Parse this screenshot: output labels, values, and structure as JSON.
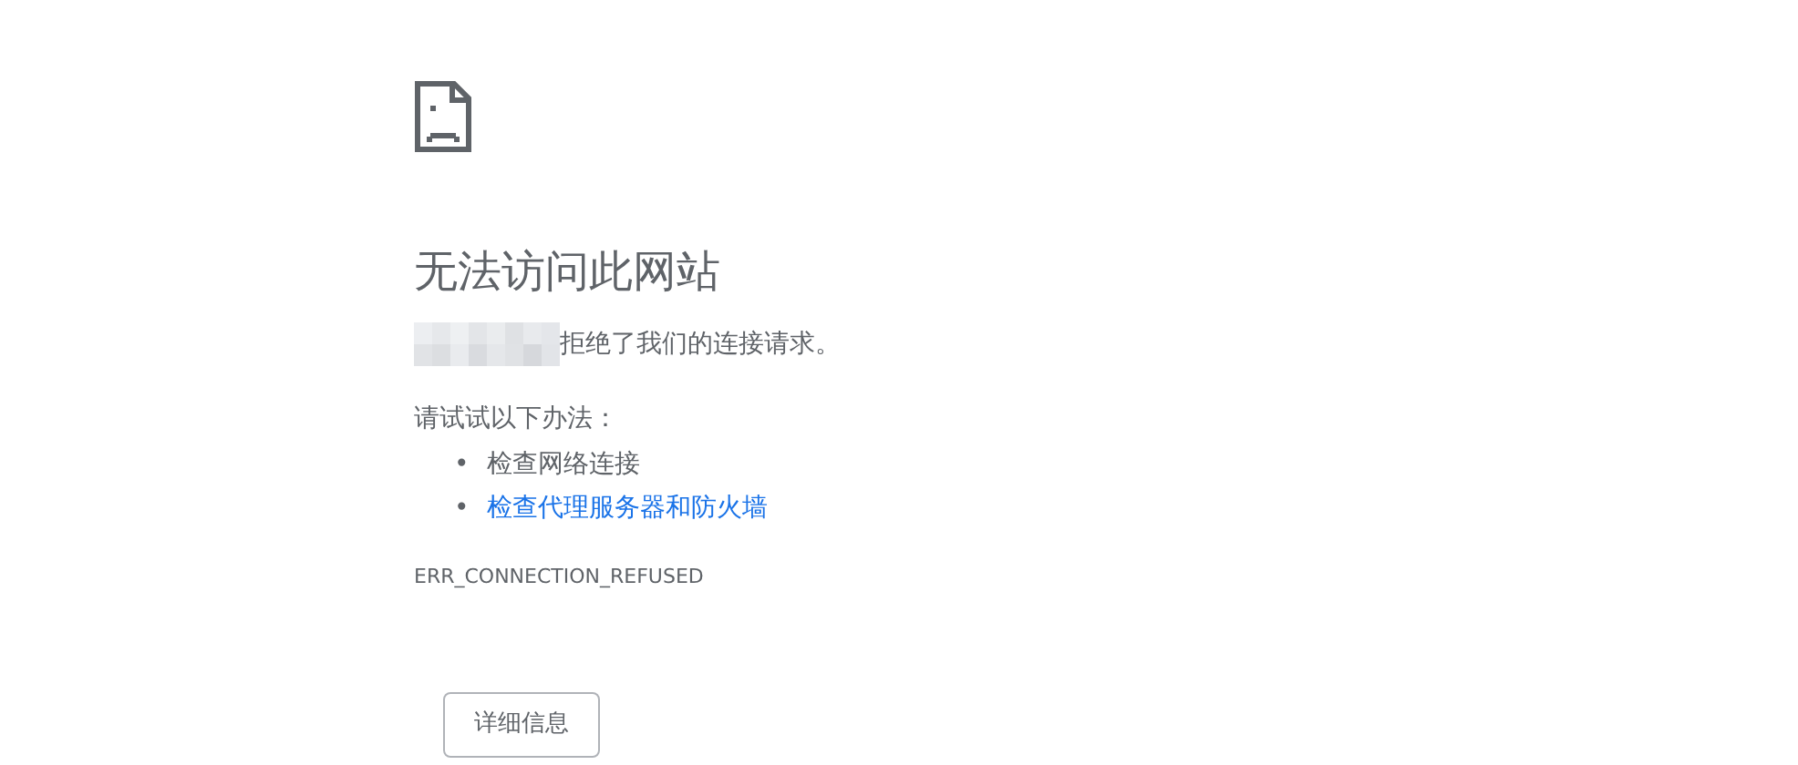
{
  "heading": "无法访问此网站",
  "message": "拒绝了我们的连接请求。",
  "suggestions_title": "请试试以下办法：",
  "suggestions": [
    {
      "marker": "•",
      "text": "检查网络连接",
      "kind": "text"
    },
    {
      "marker": "•",
      "text": "检查代理服务器和防火墙",
      "kind": "link"
    }
  ],
  "error_code": "ERR_CONNECTION_REFUSED",
  "details_button": "详细信息"
}
